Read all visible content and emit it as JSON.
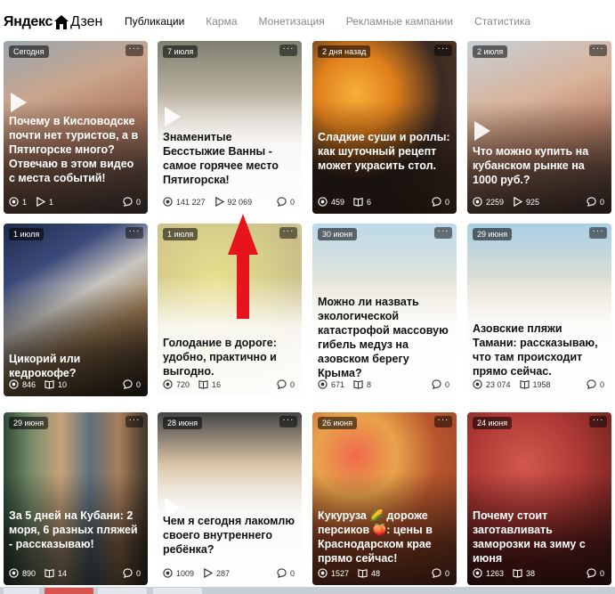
{
  "header": {
    "logo_part1": "Яндекс",
    "logo_part2": "Дзен",
    "nav": [
      {
        "label": "Публикации",
        "active": true
      },
      {
        "label": "Карма",
        "active": false
      },
      {
        "label": "Монетизация",
        "active": false
      },
      {
        "label": "Рекламные кампании",
        "active": false
      },
      {
        "label": "Статистика",
        "active": false
      }
    ]
  },
  "cards": [
    {
      "date": "Сегодня",
      "title": "Почему в Кисловодске почти нет туристов, а в Пятигорске много? Отвечаю в этом видео с места событий!",
      "views": "1",
      "reads": "1",
      "comments": "0",
      "reads_icon": "play-icon",
      "video": true,
      "light": false
    },
    {
      "date": "7 июля",
      "title": "Знаменитые Бесстыжие Ванны - самое горячее место Пятигорска!",
      "views": "141 227",
      "reads": "92 069",
      "comments": "0",
      "reads_icon": "play-icon",
      "video": true,
      "light": true
    },
    {
      "date": "2 дня назад",
      "title": "Сладкие суши и роллы: как шуточный рецепт может украсить стол.",
      "views": "459",
      "reads": "6",
      "comments": "0",
      "reads_icon": "book-icon",
      "video": false,
      "light": false
    },
    {
      "date": "2 июля",
      "title": "Что можно купить на кубанском рынке на 1000 руб.?",
      "views": "2259",
      "reads": "925",
      "comments": "0",
      "reads_icon": "play-icon",
      "video": true,
      "light": false
    },
    {
      "date": "1 июля",
      "title": "Цикорий или кедрокофе?",
      "views": "846",
      "reads": "10",
      "comments": "0",
      "reads_icon": "book-icon",
      "video": false,
      "light": false
    },
    {
      "date": "1 июля",
      "title": "Голодание в дороге: удобно, практично и выгодно.",
      "views": "720",
      "reads": "16",
      "comments": "0",
      "reads_icon": "book-icon",
      "video": false,
      "light": true
    },
    {
      "date": "30 июня",
      "title": "Можно ли назвать экологической катастрофой массовую гибель медуз на азовском берегу Крыма?",
      "views": "671",
      "reads": "8",
      "comments": "0",
      "reads_icon": "book-icon",
      "video": false,
      "light": true
    },
    {
      "date": "29 июня",
      "title": "Азовские пляжи Тамани: рассказываю, что там происходит прямо сейчас.",
      "views": "23 074",
      "reads": "1958",
      "comments": "0",
      "reads_icon": "book-icon",
      "video": false,
      "light": true
    },
    {
      "date": "29 июня",
      "title": "За 5 дней на Кубани: 2 моря, 6 разных пляжей - рассказываю!",
      "views": "890",
      "reads": "14",
      "comments": "0",
      "reads_icon": "book-icon",
      "video": false,
      "light": false
    },
    {
      "date": "28 июня",
      "title": "Чем я сегодня лакомлю своего внутреннего ребёнка?",
      "views": "1009",
      "reads": "287",
      "comments": "0",
      "reads_icon": "play-icon",
      "video": true,
      "light": true
    },
    {
      "date": "26 июня",
      "title": "Кукуруза 🌽 дороже персиков 🍑: цены в Краснодарском крае прямо сейчас!",
      "views": "1527",
      "reads": "48",
      "comments": "0",
      "reads_icon": "book-icon",
      "video": false,
      "light": false
    },
    {
      "date": "24 июня",
      "title": "Почему стоит заготавливать заморозки на зиму с июня",
      "views": "1263",
      "reads": "38",
      "comments": "0",
      "reads_icon": "book-icon",
      "video": false,
      "light": false
    }
  ]
}
